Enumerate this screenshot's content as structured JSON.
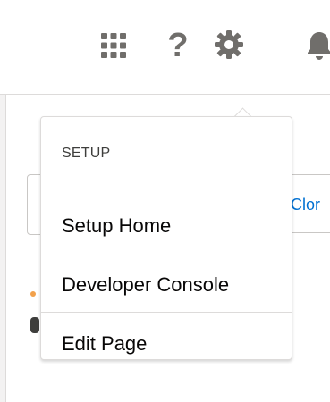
{
  "header": {
    "icons": [
      "app-launcher-icon",
      "help-icon",
      "gear-icon",
      "bell-icon"
    ],
    "help_label": "?"
  },
  "background": {
    "clone_label": "Clor"
  },
  "dropdown": {
    "heading": "SETUP",
    "items": [
      {
        "label": "Setup Home"
      },
      {
        "label": "Developer Console"
      },
      {
        "label": "Edit Page"
      }
    ]
  },
  "colors": {
    "icon_gray": "#706e6b",
    "link_blue": "#0070d2",
    "border": "#dddbda",
    "text": "#080707"
  }
}
